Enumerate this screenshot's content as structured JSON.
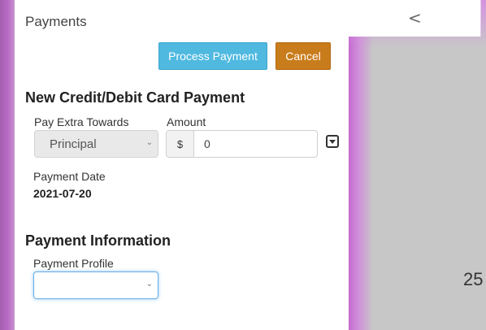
{
  "background": {
    "back_chevron": "<",
    "partial_number": "25"
  },
  "modal": {
    "title": "Payments",
    "process_button_label": "Process Payment",
    "cancel_button_label": "Cancel",
    "card_section_title": "New Credit/Debit Card Payment",
    "pay_extra_label": "Pay Extra Towards",
    "pay_extra_selected": "Principal",
    "amount_label": "Amount",
    "amount_currency": "$",
    "amount_value": "0",
    "payment_date_label": "Payment Date",
    "payment_date_value": "2021-07-20",
    "payment_info_title": "Payment Information",
    "payment_profile_label": "Payment Profile",
    "payment_profile_selected": ""
  },
  "colors": {
    "process_button": "#4fb9e0",
    "cancel_button": "#c97c1b",
    "focus_border": "#66afe9"
  },
  "icons": {
    "back": "chevron-left-icon",
    "select_caret": "chevron-down-icon",
    "amount_toggle": "caret-square-down-icon"
  }
}
